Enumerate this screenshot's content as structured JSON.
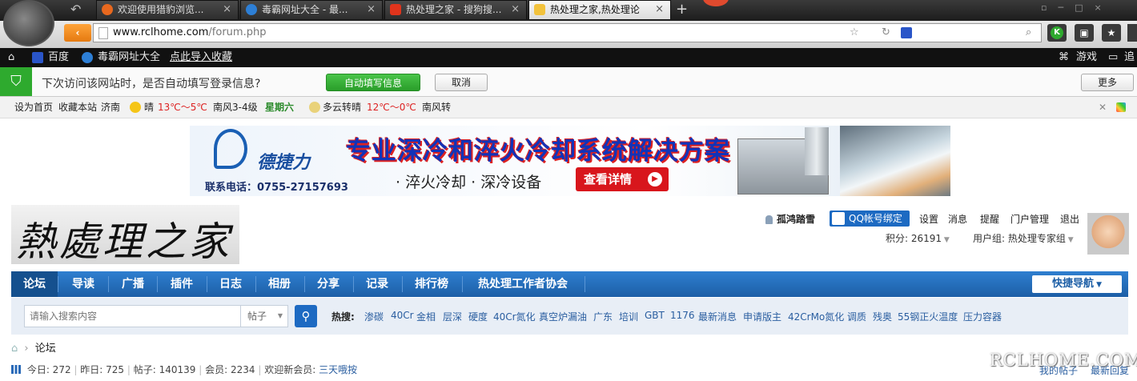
{
  "tabs": [
    {
      "label": "欢迎使用猎豹浏览...",
      "icon_color": "#e8681e"
    },
    {
      "label": "毒霸网址大全 - 最...",
      "icon_color": "#2d7fd6"
    },
    {
      "label": "热处理之家 - 搜狗搜...",
      "icon_color": "#e0341c"
    },
    {
      "label": "热处理之家,热处理论",
      "icon_color": "#f2c23c"
    }
  ],
  "address": {
    "url": "www.rclhome.com/forum.php",
    "url_domain": "www.rclhome.com",
    "url_path": "/forum.php"
  },
  "bookmarks": {
    "items": [
      "百度",
      "毒霸网址大全",
      "点此导入收藏"
    ],
    "right": [
      "游戏",
      "追"
    ]
  },
  "autofill": {
    "prompt": "下次访问该网站时，是否自动填写登录信息?",
    "accept": "自动填写信息",
    "cancel": "取消",
    "more": "更多"
  },
  "weather": {
    "set_home": "设为首页",
    "bookmark": "收藏本站",
    "city": "济南",
    "today_cond": "晴",
    "today_temp": "13℃～5℃",
    "today_wind": "南风3-4级",
    "weekday": "星期六",
    "tomorrow_cond": "多云转晴",
    "tomorrow_temp": "12℃～0℃",
    "tomorrow_wind": "南风转"
  },
  "banner": {
    "brand": "德捷力",
    "headline": "专业深冷和淬火冷却系统解决方案",
    "phone": "联系电话：0755-27157693",
    "sub": "· 淬火冷却 · 深冷设备",
    "cta": "查看详情"
  },
  "logo_text": "熱處理之家",
  "user": {
    "name": "孤鸿踏雪",
    "qq_bind": "QQ帐号绑定",
    "links": [
      "设置",
      "消息",
      "提醒",
      "门户管理",
      "退出"
    ],
    "points": "积分: 26191",
    "group": "用户组: 热处理专家组"
  },
  "nav": {
    "items": [
      "论坛",
      "导读",
      "广播",
      "插件",
      "日志",
      "相册",
      "分享",
      "记录",
      "排行榜",
      "热处理工作者协会"
    ],
    "quick": "快捷导航"
  },
  "search": {
    "placeholder": "请输入搜索内容",
    "scope": "帖子",
    "hot_label": "热搜:",
    "hot": [
      "渗碳",
      "40Cr",
      "金相",
      "层深",
      "硬度",
      "40Cr氮化",
      "真空炉漏油",
      "广东",
      "培训",
      "GBT",
      "1176",
      "最新消息",
      "申请版主",
      "42CrMo氮化",
      "调质",
      "残奥",
      "55钢正火温度",
      "压力容器"
    ]
  },
  "breadcrumb": "论坛",
  "stats": {
    "today": "今日: 272",
    "yesterday": "昨日: 725",
    "posts": "帖子: 140139",
    "members": "会员: 2234",
    "newest_label": "欢迎新会员:",
    "newest": "三天哦按"
  },
  "bottom_links": [
    "我的帖子",
    "最新回复"
  ],
  "watermark": "RCLHOME.COM",
  "colors": {
    "nav": "#1c5ea6",
    "link": "#2a5ea0",
    "green_btn": "#2eaa2e"
  }
}
